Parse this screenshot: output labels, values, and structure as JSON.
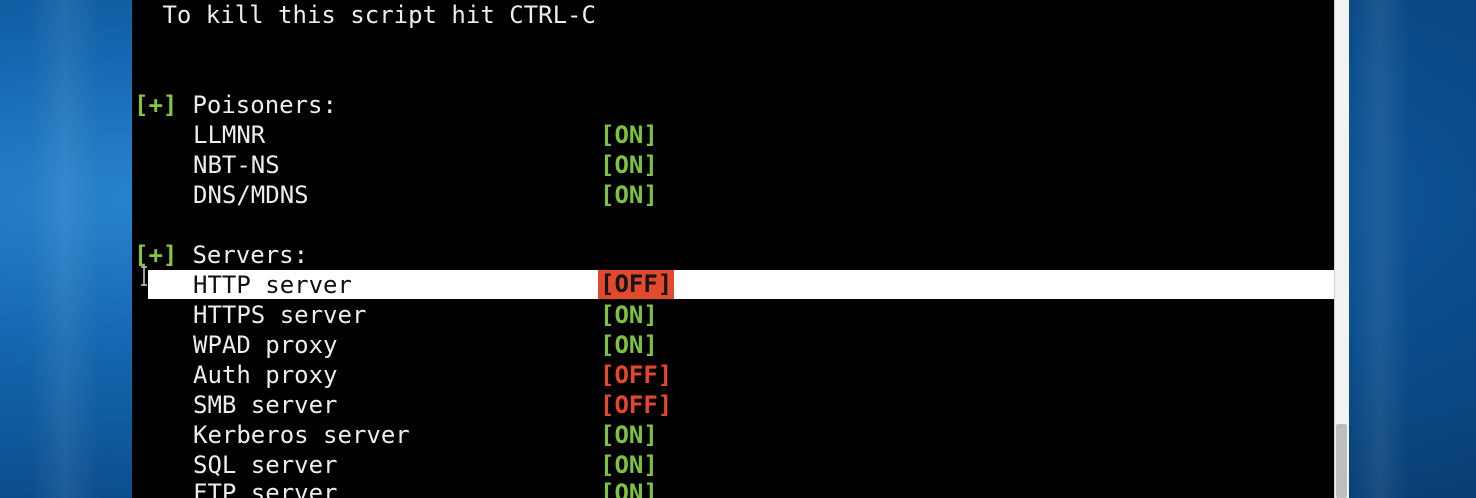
{
  "terminal": {
    "header_line": " To kill this script hit CTRL-C",
    "sections": [
      {
        "bracket": "[+]",
        "title": " Poisoners:",
        "items": [
          {
            "name": "LLMNR",
            "status": "[ON]"
          },
          {
            "name": "NBT-NS",
            "status": "[ON]"
          },
          {
            "name": "DNS/MDNS",
            "status": "[ON]"
          }
        ]
      },
      {
        "bracket": "[+]",
        "title": " Servers:",
        "items": [
          {
            "name": "HTTP server",
            "status": "[OFF]"
          },
          {
            "name": "HTTPS server",
            "status": "[ON]"
          },
          {
            "name": "WPAD proxy",
            "status": "[ON]"
          },
          {
            "name": "Auth proxy",
            "status": "[OFF]"
          },
          {
            "name": "SMB server",
            "status": "[OFF]"
          },
          {
            "name": "Kerberos server",
            "status": "[ON]"
          },
          {
            "name": "SQL server",
            "status": "[ON]"
          },
          {
            "name": "FTP server",
            "status": "[ON]"
          }
        ]
      }
    ]
  },
  "colors": {
    "background": "#000000",
    "text": "#ececec",
    "on": "#7dc23f",
    "off": "#e8452b",
    "selection": "#ffffff"
  }
}
